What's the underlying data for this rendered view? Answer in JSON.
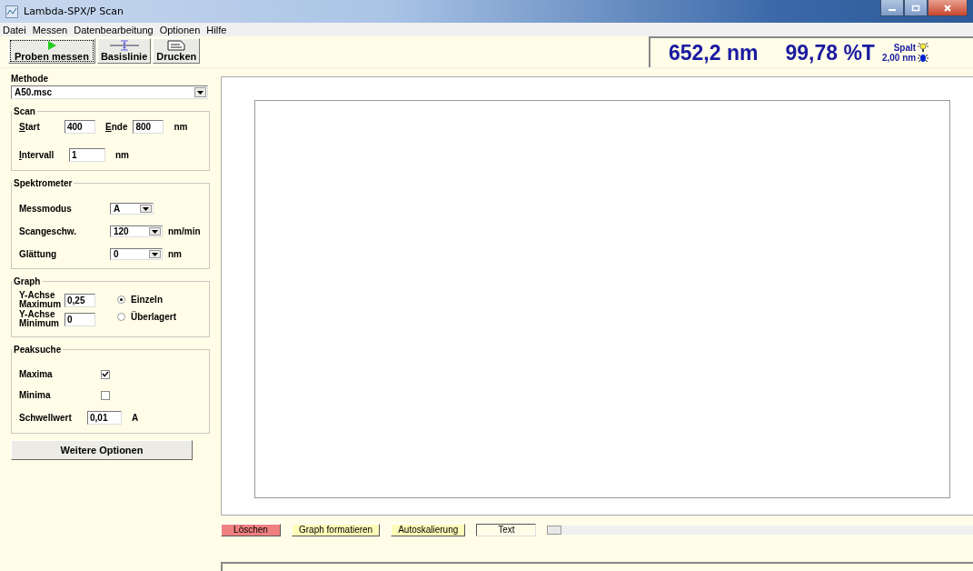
{
  "window": {
    "title": "Lambda-SPX/P Scan"
  },
  "menu": [
    "Datei",
    "Messen",
    "Datenbearbeitung",
    "Optionen",
    "Hilfe"
  ],
  "toolbar": [
    {
      "label": "Proben messen",
      "kind": "play",
      "focused": true
    },
    {
      "label": "Basislinie",
      "kind": "baseline",
      "focused": false
    },
    {
      "label": "Drucken",
      "kind": "print",
      "focused": false
    }
  ],
  "readout": {
    "wavelength": "652,2 nm",
    "value": "99,78 %T",
    "slit_label": "Spalt",
    "slit_value": "2,00 nm"
  },
  "method": {
    "label": "Methode",
    "value": "A50.msc"
  },
  "scan": {
    "title": "Scan",
    "start_label": "Start",
    "start": "400",
    "end_label": "Ende",
    "end": "800",
    "unit": "nm",
    "interval_label": "Intervall",
    "interval": "1",
    "interval_unit": "nm"
  },
  "spectrometer": {
    "title": "Spektrometer",
    "rows": [
      {
        "label": "Messmodus",
        "value": "A",
        "unit": ""
      },
      {
        "label": "Scangeschw.",
        "value": "120",
        "unit": "nm/min"
      },
      {
        "label": "Glättung",
        "value": "0",
        "unit": "nm"
      }
    ]
  },
  "graph": {
    "title": "Graph",
    "axes": [
      {
        "label": "Y-Achse",
        "sub": "Maximum",
        "value": "0,25"
      },
      {
        "label": "Y-Achse",
        "sub": "Minimum",
        "value": "0"
      }
    ],
    "modes": [
      {
        "label": "Einzeln",
        "selected": true
      },
      {
        "label": "Überlagert",
        "selected": false
      }
    ]
  },
  "peaks": {
    "title": "Peaksuche",
    "checks": [
      {
        "label": "Maxima",
        "checked": true
      },
      {
        "label": "Minima",
        "checked": false
      }
    ],
    "threshold_label": "Schwellwert",
    "threshold": "0,01",
    "threshold_unit": "A"
  },
  "more_button": "Weitere Optionen",
  "graph_buttons": [
    {
      "label": "Löschen",
      "kind": "danger"
    },
    {
      "label": "Graph formatieren",
      "kind": "normal"
    },
    {
      "label": "Autoskalierung",
      "kind": "normal"
    },
    {
      "label": "Text",
      "kind": "text"
    }
  ]
}
